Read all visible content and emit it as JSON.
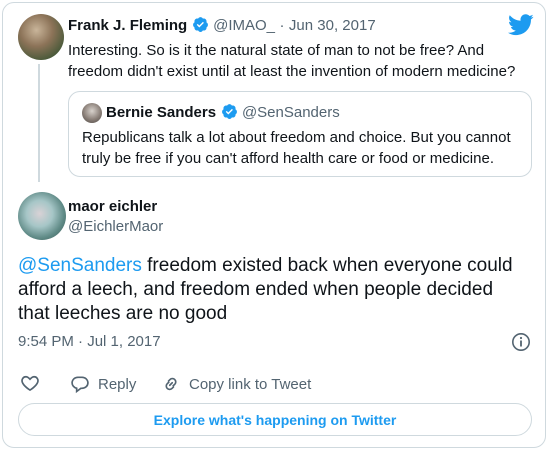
{
  "quoted_parent": {
    "author_name": "Frank J. Fleming",
    "author_handle": "@IMAO_",
    "date": "Jun 30, 2017",
    "separator": "·",
    "text": "Interesting. So is it the natural state of man to not be free? And freedom didn't exist until at least the invention of modern medicine?",
    "quote": {
      "author_name": "Bernie Sanders",
      "author_handle": "@SenSanders",
      "text": "Republicans talk a lot about freedom and choice. But you cannot truly be free if you can't afford health care or food or medicine."
    }
  },
  "tweet": {
    "author_name": "maor eichler",
    "author_handle": "@EichlerMaor",
    "mention": "@SenSanders",
    "text": " freedom existed back when everyone could afford a leech, and freedom ended when people decided that leeches are no good",
    "timestamp": "9:54 PM · Jul 1, 2017"
  },
  "actions": {
    "reply_label": "Reply",
    "copy_link_label": "Copy link to Tweet"
  },
  "explore_label": "Explore what's happening on Twitter",
  "colors": {
    "accent": "#1d9bf0",
    "text": "#0f1419",
    "muted": "#536471",
    "border": "#cfd9de"
  },
  "icons": [
    "twitter-bird-icon",
    "verified-badge-icon",
    "info-icon",
    "heart-icon",
    "reply-icon",
    "link-icon"
  ]
}
